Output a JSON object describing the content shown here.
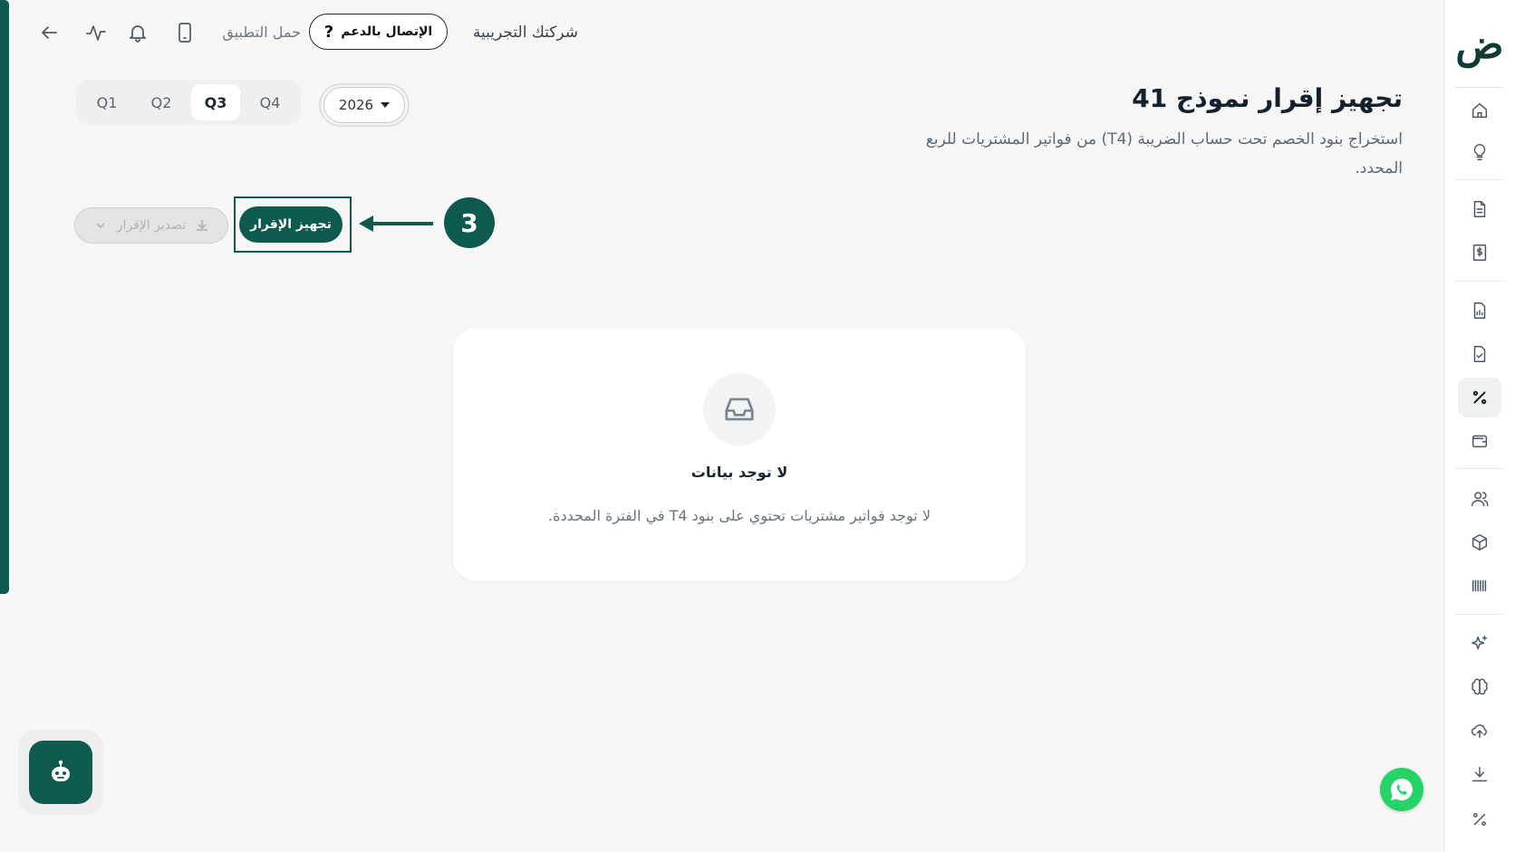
{
  "header": {
    "company_name": "شركتك التجريبية",
    "support_label": "الإتصال بالدعم",
    "download_app_label": "حمل التطبيق"
  },
  "page": {
    "title": "تجهيز إقرار نموذج 41",
    "description": "استخراج بنود الخصم تحت حساب الضريبة (T4) من فواتير المشتريات للربع المحدد."
  },
  "quarters": [
    "Q1",
    "Q2",
    "Q3",
    "Q4"
  ],
  "selected_quarter": "Q3",
  "year": "2026",
  "actions": {
    "prepare_label": "تجهيز الإقرار",
    "export_label": "تصدير الإقرار"
  },
  "annotation": {
    "step_number": "3"
  },
  "empty_state": {
    "title": "لا توجد بيانات",
    "description": "لا توجد فواتير مشتريات تحتوي على بنود T4 في الفترة المحددة."
  },
  "logo_text": "ض",
  "sidebar_icons": [
    "home-icon",
    "lightbulb-icon",
    "document-icon",
    "invoice-icon",
    "report-icon",
    "file-check-icon",
    "percent-icon",
    "wallet-icon",
    "users-icon",
    "box-icon",
    "barcode-icon",
    "sparkles-icon",
    "brain-icon",
    "upload-cloud-icon",
    "download-icon",
    "percent-icon"
  ],
  "colors": {
    "brand": "#0f5a4e",
    "whatsapp": "#25d366"
  }
}
